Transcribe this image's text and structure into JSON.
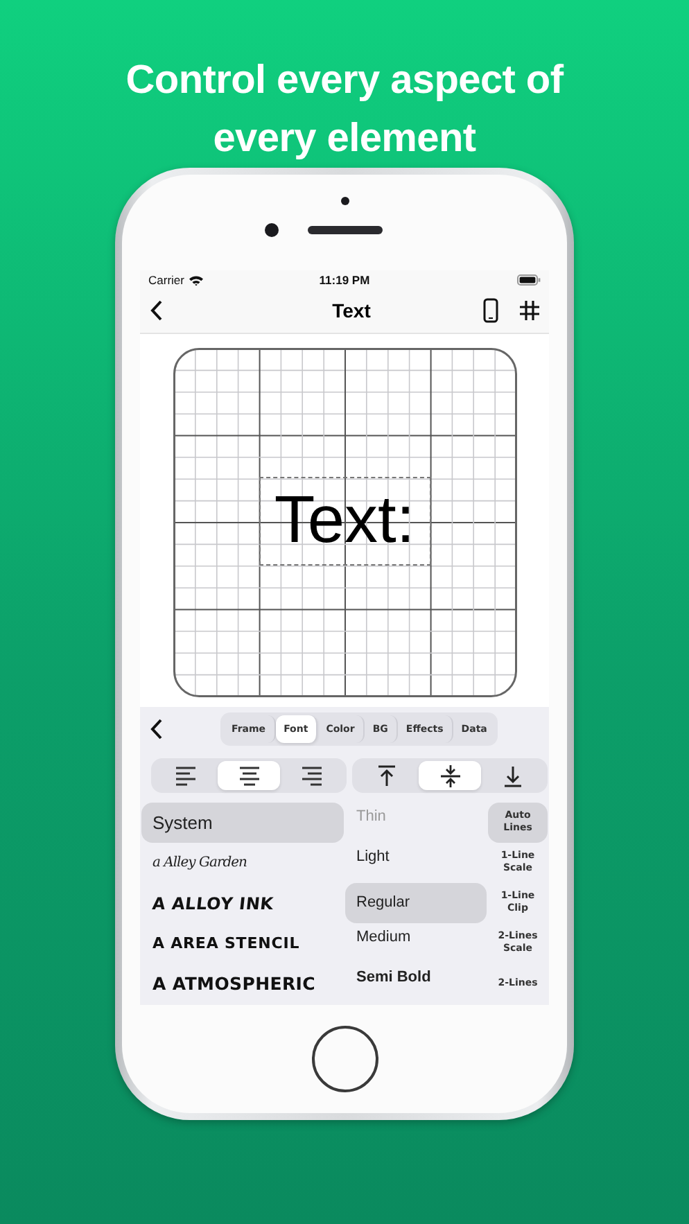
{
  "headline_lines": [
    "Control every aspect of",
    "every element"
  ],
  "status_bar": {
    "carrier": "Carrier",
    "time": "11:19 PM"
  },
  "nav_bar": {
    "title": "Text"
  },
  "canvas": {
    "text": "Text:"
  },
  "tabs": [
    {
      "label": "Frame",
      "selected": false
    },
    {
      "label": "Font",
      "selected": true
    },
    {
      "label": "Color",
      "selected": false
    },
    {
      "label": "BG",
      "selected": false
    },
    {
      "label": "Effects",
      "selected": false
    },
    {
      "label": "Data",
      "selected": false
    }
  ],
  "alignment": {
    "horizontal": [
      {
        "kind": "left",
        "selected": false
      },
      {
        "kind": "center",
        "selected": true
      },
      {
        "kind": "right",
        "selected": false
      }
    ],
    "vertical": [
      {
        "kind": "top",
        "selected": false
      },
      {
        "kind": "middle",
        "selected": true
      },
      {
        "kind": "bottom",
        "selected": false
      }
    ]
  },
  "fonts": [
    {
      "name": "System",
      "kind": "system",
      "selected": true
    },
    {
      "name": "a Alley Garden",
      "kind": "script",
      "selected": false
    },
    {
      "name": "A ALLOY INK",
      "kind": "brush",
      "selected": false
    },
    {
      "name": "A AREA STENCIL",
      "kind": "stencil",
      "selected": false
    },
    {
      "name": "A ATMOSPHERIC",
      "kind": "display",
      "selected": false
    }
  ],
  "weights": [
    {
      "label": "Thin",
      "selected": false,
      "disabled": true
    },
    {
      "label": "Light",
      "selected": false,
      "disabled": false
    },
    {
      "label": "Regular",
      "selected": true,
      "disabled": false
    },
    {
      "label": "Medium",
      "selected": false,
      "disabled": false
    },
    {
      "label": "Semi Bold",
      "selected": false,
      "disabled": false
    }
  ],
  "line_modes": [
    {
      "lines": [
        "Auto",
        "Lines"
      ],
      "selected": true
    },
    {
      "lines": [
        "1-Line",
        "Scale"
      ],
      "selected": false
    },
    {
      "lines": [
        "1-Line",
        "Clip"
      ],
      "selected": false
    },
    {
      "lines": [
        "2-Lines",
        "Scale"
      ],
      "selected": false
    },
    {
      "lines": [
        "2-Lines"
      ],
      "selected": false
    }
  ]
}
